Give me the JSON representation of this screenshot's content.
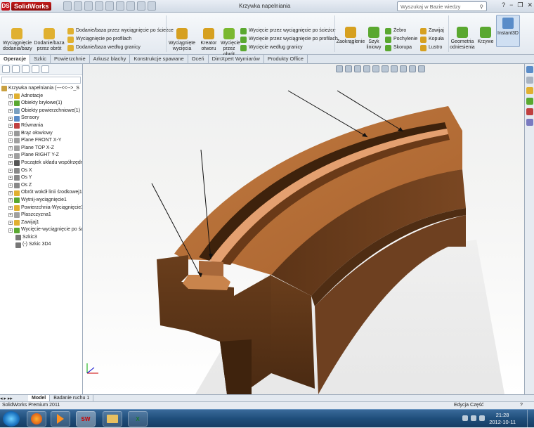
{
  "app": {
    "brand": "SolidWorks",
    "doc_title": "Krzywka napelniania",
    "search_placeholder": "Wyszukaj w Bazie wiedzy"
  },
  "ribbon": {
    "extrude_boss": "Wyciągnięcie dodania/bazy",
    "revolve_boss": "Dodanie/baza przez obrót",
    "list1": [
      "Dodanie/baza przez wyciągnięcie po ścieżce",
      "Wyciągnięcie po profilach",
      "Dodanie/baza według granicy"
    ],
    "extrude_cut": "Wyciągnięte wycięcia",
    "hole_wizard": "Kreator otworu",
    "revolve_cut": "Wycięcie przez obrót",
    "list2": [
      "Wycięcie przez wyciągnięcie po ścieżce",
      "Wycięcie przez wyciągnięcie po profilach",
      "Wycięcie według granicy"
    ],
    "fillet": "Zaokrąglenie",
    "pattern": "Szyk liniowy",
    "list3": [
      "Żebro",
      "Pochylenie",
      "Skorupa"
    ],
    "list4": [
      "Zawijaj",
      "Kopuła",
      "Lustro"
    ],
    "ref_geom": "Geometria odniesienia",
    "curves": "Krzywe",
    "instant3d": "Instant3D"
  },
  "tabs": [
    "Operacje",
    "Szkic",
    "Powierzchnie",
    "Arkusz blachy",
    "Konstrukcje spawane",
    "Oceń",
    "DimXpert Wymiarów",
    "Produkty Office"
  ],
  "tree": [
    {
      "label": "Krzywka napelniania  (---<<-->_S",
      "indent": 0
    },
    {
      "label": "Adnotacje",
      "indent": 1
    },
    {
      "label": "Obiekty bryłowe(1)",
      "indent": 1
    },
    {
      "label": "Obiekty powierzchniowe(1)",
      "indent": 1
    },
    {
      "label": "Sensory",
      "indent": 1
    },
    {
      "label": "Równania",
      "indent": 1
    },
    {
      "label": "Brąz ołowiowy",
      "indent": 1
    },
    {
      "label": "Plane FRONT X-Y",
      "indent": 1
    },
    {
      "label": "Plane TOP X-Z",
      "indent": 1
    },
    {
      "label": "Plane RIGHT Y-Z",
      "indent": 1
    },
    {
      "label": "Początek układu współrzędny",
      "indent": 1
    },
    {
      "label": "Os X",
      "indent": 1
    },
    {
      "label": "Os Y",
      "indent": 1
    },
    {
      "label": "Os Z",
      "indent": 1
    },
    {
      "label": "Obrót wokół linii środkowej1",
      "indent": 1
    },
    {
      "label": "Wytnij-wyciągnięcie1",
      "indent": 1
    },
    {
      "label": "Powierzchnia-Wyciągnięcie1",
      "indent": 1
    },
    {
      "label": "Płaszczyzna1",
      "indent": 1
    },
    {
      "label": "Zawijaj1",
      "indent": 1
    },
    {
      "label": "Wycięcie-wyciągnięcie po śc",
      "indent": 1
    },
    {
      "label": "Szkic3",
      "indent": 2
    },
    {
      "label": "(-) Szkic 3D4",
      "indent": 2
    }
  ],
  "bottom_tabs": [
    "Model",
    "Badanie ruchu 1"
  ],
  "status": {
    "left": "SolidWorks Premium 2011",
    "mode": "Edycja Część"
  },
  "clock": {
    "time": "21:28",
    "date": "2012-10-11"
  },
  "colors": {
    "part_top": "#b8703a",
    "part_dark": "#5a3418",
    "accent": "#1a72c0"
  }
}
